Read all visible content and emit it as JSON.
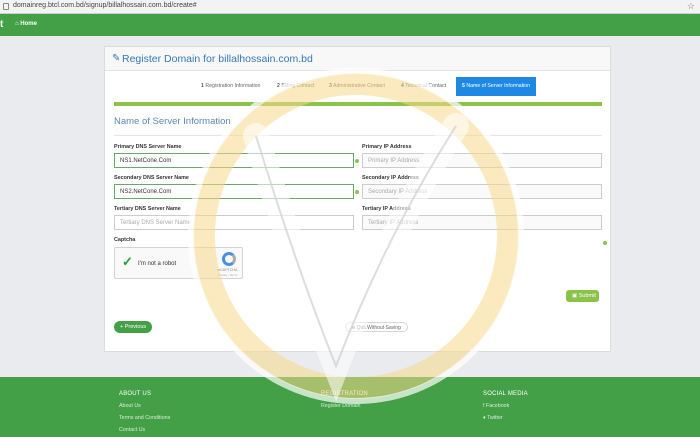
{
  "browser": {
    "url": "domainreg.btcl.com.bd/signup/billalhossain.com.bd/create#",
    "star_icon": "star-icon"
  },
  "navbar": {
    "brand": "t",
    "home_label": "Home"
  },
  "panel": {
    "title": "Register Domain for billalhossain.com.bd"
  },
  "steps": [
    {
      "num": "1",
      "label": "Registration Information"
    },
    {
      "num": "2",
      "label": "Billing Contact"
    },
    {
      "num": "3",
      "label": "Administrative Contact"
    },
    {
      "num": "4",
      "label": "Technical Contact"
    },
    {
      "num": "5",
      "label": "Name of Server Information"
    }
  ],
  "section_title": "Name of Server Information",
  "form": {
    "primary_dns_label": "Primary DNS Server Name",
    "primary_dns_value": "NS1.NetCone.Com",
    "primary_ip_label": "Primary IP Address",
    "primary_ip_placeholder": "Primary IP Address",
    "secondary_dns_label": "Secondary DNS Server Name",
    "secondary_dns_value": "NS2.NetCone.Com",
    "secondary_ip_label": "Secondary IP Address",
    "secondary_ip_placeholder": "Secondary IP Address",
    "tertiary_dns_label": "Tertiary DNS Server Name",
    "tertiary_dns_placeholder": "Tertiary DNS Server Name",
    "tertiary_ip_label": "Tertiary IP Address",
    "tertiary_ip_placeholder": "Tertiary IP Address",
    "captcha_label": "Captcha"
  },
  "captcha": {
    "text": "I'm not a robot",
    "brand": "reCAPTCHA",
    "links": "Privacy - Terms"
  },
  "buttons": {
    "submit": "Submit",
    "previous": "Previous",
    "quit": "Quit Without Saving"
  },
  "footer": {
    "about": {
      "title": "ABOUT US",
      "links": [
        "About Us",
        "Terms and Conditions",
        "Contact Us"
      ]
    },
    "registration": {
      "title": "REGISTRATION",
      "links": [
        "Register Domain"
      ]
    },
    "social": {
      "title": "SOCIAL MEDIA",
      "links": [
        "Facebook",
        "Twitter"
      ]
    }
  },
  "colors": {
    "brand_green": "#43a047",
    "accent_blue": "#1e88e5",
    "success_green": "#8bc34a"
  }
}
